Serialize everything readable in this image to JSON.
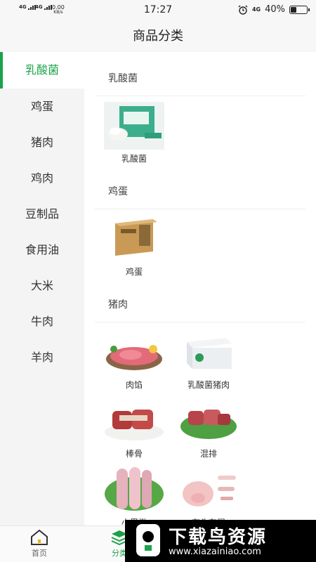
{
  "status_bar": {
    "signal_1": "4G",
    "signal_2": "4G",
    "net_speed_value": "0.00",
    "net_speed_unit": "KB/s",
    "time": "17:27",
    "network_right": "4G",
    "battery": "40%",
    "battery_level": 0.4
  },
  "header": {
    "title": "商品分类"
  },
  "sidebar": {
    "items": [
      {
        "label": "乳酸菌",
        "active": true
      },
      {
        "label": "鸡蛋"
      },
      {
        "label": "猪肉"
      },
      {
        "label": "鸡肉"
      },
      {
        "label": "豆制品"
      },
      {
        "label": "食用油"
      },
      {
        "label": "大米"
      },
      {
        "label": "牛肉"
      },
      {
        "label": "羊肉"
      }
    ]
  },
  "sections": [
    {
      "title": "乳酸菌",
      "products": [
        {
          "name": "乳酸菌"
        }
      ]
    },
    {
      "title": "鸡蛋",
      "products": [
        {
          "name": "鸡蛋"
        }
      ]
    },
    {
      "title": "猪肉",
      "products": [
        {
          "name": "肉馅"
        },
        {
          "name": "乳酸菌猪肉"
        },
        {
          "name": "棒骨"
        },
        {
          "name": "混排"
        },
        {
          "name": "小里脊"
        },
        {
          "name": "有头有尾"
        }
      ]
    }
  ],
  "tabbar": {
    "tabs": [
      {
        "label": "首页"
      },
      {
        "label": "分类"
      }
    ]
  },
  "watermark": {
    "text": "下载鸟资源",
    "url": "www.xiazainiao.com"
  },
  "colors": {
    "accent": "#1aa34a",
    "sidebar_bg": "#f4f4f4",
    "header_bg": "#f7f7f7"
  }
}
